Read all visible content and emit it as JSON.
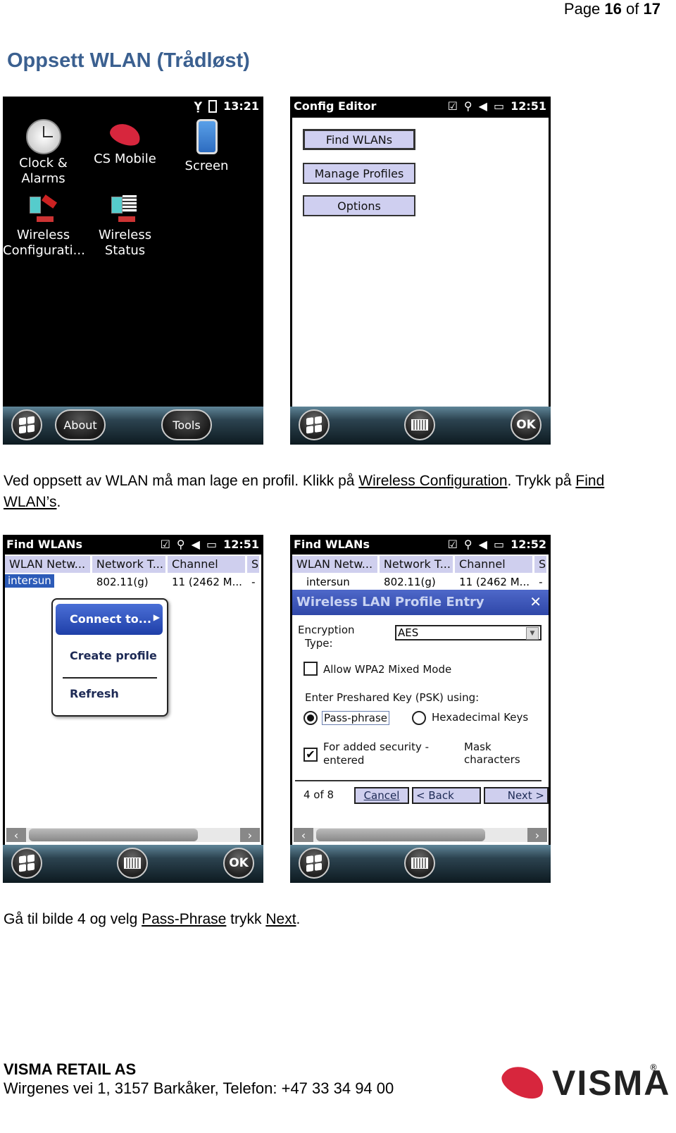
{
  "page": {
    "prefix": "Page",
    "current": "16",
    "of": "of",
    "total": "17"
  },
  "title": "Oppsett WLAN (Trådløst)",
  "screen1": {
    "time": "13:21",
    "icons": [
      {
        "label1": "Clock &",
        "label2": "Alarms",
        "icon": "clock-icon"
      },
      {
        "label1": "CS Mobile",
        "label2": "",
        "icon": "cs-mobile-icon"
      },
      {
        "label1": "Screen",
        "label2": "",
        "icon": "screen-icon"
      },
      {
        "label1": "Wireless",
        "label2": "Configurati...",
        "icon": "wireless-config-icon"
      },
      {
        "label1": "Wireless",
        "label2": "Status",
        "icon": "wireless-status-icon"
      }
    ],
    "softkeys": {
      "left": "About",
      "right": "Tools"
    }
  },
  "screen2": {
    "title": "Config Editor",
    "time": "12:51",
    "buttons": [
      "Find WLANs",
      "Manage Profiles",
      "Options"
    ],
    "ok": "OK"
  },
  "para1": {
    "text1": "Ved oppsett av WLAN må man lage en profil. Klikk på ",
    "link1": "Wireless Configuration",
    "text2": ". Trykk på ",
    "link2": "Find",
    "link3": "WLAN’s",
    "text3": "."
  },
  "screen3": {
    "title": "Find WLANs",
    "time": "12:51",
    "columns": [
      "WLAN Netw...",
      "Network T...",
      "Channel",
      "S"
    ],
    "row": {
      "ssid": "intersun",
      "type": "802.11(g)",
      "channel": "11 (2462 M...",
      "signal": "-"
    },
    "menu": [
      "Connect to...",
      "Create profile",
      "Refresh"
    ],
    "ok": "OK"
  },
  "screen4": {
    "title": "Find WLANs",
    "time": "12:52",
    "columns": [
      "WLAN Netw...",
      "Network T...",
      "Channel",
      "S"
    ],
    "row": {
      "ssid": "intersun",
      "type": "802.11(g)",
      "channel": "11 (2462 M...",
      "signal": "-"
    },
    "dialog": {
      "title": "Wireless LAN Profile Entry",
      "close": "✕",
      "encryption_label1": "Encryption",
      "encryption_label2": "Type:",
      "encryption_value": "AES",
      "mixed_mode": "Allow WPA2 Mixed Mode",
      "mixed_mode_checked": false,
      "psk_label": "Enter Preshared Key (PSK) using:",
      "radio_pass": "Pass-phrase",
      "radio_hex": "Hexadecimal Keys",
      "selected": "Pass-phrase",
      "security1": "For added security -",
      "security2": "entered",
      "mask": "Mask characters",
      "mask_checked": true,
      "step": "4 of 8",
      "cancel": "Cancel",
      "back": "< Back",
      "next": "Next >"
    }
  },
  "para2": {
    "text1": "Gå til bilde 4 og velg ",
    "link1": "Pass-Phrase",
    "text2": " trykk ",
    "link2": "Next",
    "text3": "."
  },
  "footer": {
    "company": "VISMA RETAIL AS",
    "address": "Wirgenes vei 1, 3157 Barkåker, Telefon: +47 33 34 94 00",
    "logo": "VISMA",
    "reg": "®"
  },
  "colors": {
    "heading": "#3b6090",
    "button_fill": "#cfcff0",
    "dialog_title": "#3a52b5",
    "visma_red": "#d7263d"
  }
}
